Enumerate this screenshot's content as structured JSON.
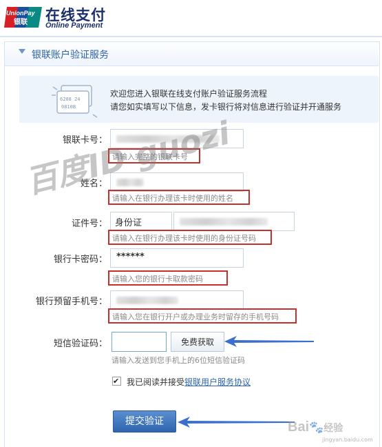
{
  "header": {
    "logo_top": "UnionPay",
    "logo_bottom": "银联",
    "title_cn": "在线支付",
    "title_en": "Online Payment"
  },
  "panel": {
    "title": "银联账户验证服务",
    "icon_text_1": "6208 24",
    "icon_text_2": "0810B"
  },
  "intro": {
    "line1": "欢迎您进入银联在线支付账户验证服务流程",
    "line2": "请您如实填写以下信息，发卡银行将对信息进行验证并开通服务"
  },
  "form": {
    "card_number": {
      "label": "银联卡号：",
      "hint": "请输入完整的银联卡号"
    },
    "name": {
      "label": "姓名：",
      "hint": "请输入在银行办理该卡时使用的姓名"
    },
    "id": {
      "label": "证件号：",
      "type_value": "身份证",
      "hint": "请输入在银行办理该卡时使用的身份证号码"
    },
    "password": {
      "label": "银行卡密码：",
      "value": "******",
      "hint": "请输入您的银行卡取款密码"
    },
    "phone": {
      "label": "银行预留手机号：",
      "hint": "请输入您在银行开户或办理业务时留存的手机号码"
    },
    "sms": {
      "label": "短信验证码：",
      "button": "免费获取",
      "hint": "请输入发送到您手机上的6位短信验证码"
    },
    "agree_text": "我已阅读并接受",
    "agree_link": "银联用户服务协议",
    "submit": "提交验证"
  },
  "watermark": {
    "text": "百度ID guozi",
    "baidu": "Bai",
    "baidu_tail": "经验",
    "url": "jingyan.baidu.com"
  },
  "colors": {
    "brand": "#2d64a8",
    "highlight": "#c4302b",
    "arrow": "#3a6fd0"
  }
}
